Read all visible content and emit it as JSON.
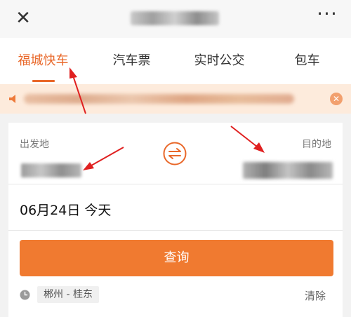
{
  "header": {
    "close_icon": "close-icon",
    "more_icon": "more-icon"
  },
  "tabs": [
    {
      "label": "福城快车",
      "active": true
    },
    {
      "label": "汽车票",
      "active": false
    },
    {
      "label": "实时公交",
      "active": false
    },
    {
      "label": "包车",
      "active": false
    }
  ],
  "search": {
    "from_label": "出发地",
    "to_label": "目的地",
    "date": "06月24日 今天",
    "query_button": "查询",
    "history": "郴州 - 桂东",
    "clear_label": "清除"
  },
  "colors": {
    "accent": "#E9682A",
    "button": "#F07A30",
    "notice_bg": "#FDEBDC"
  }
}
